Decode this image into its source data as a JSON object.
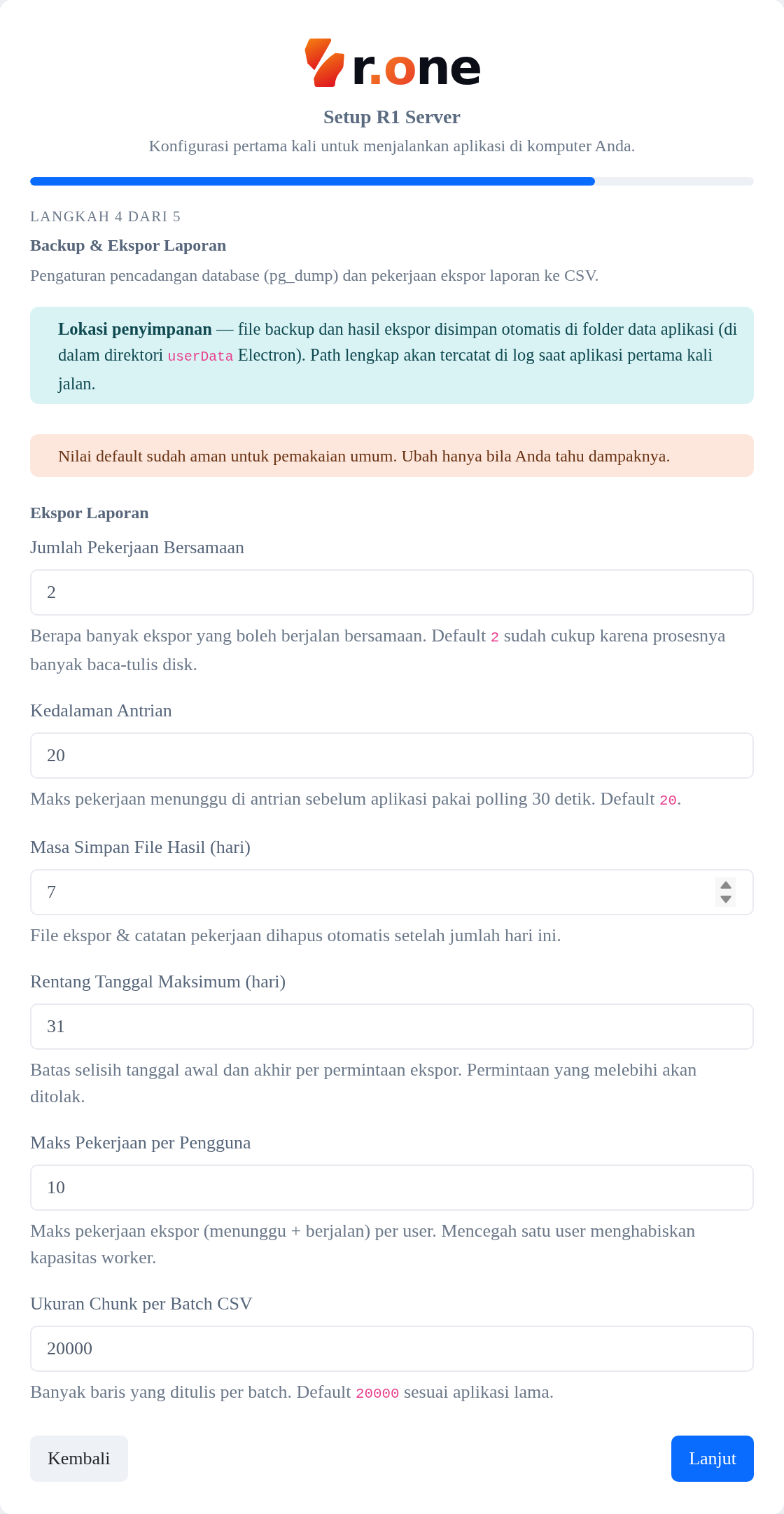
{
  "logo": {
    "wordmark": "r.one"
  },
  "header": {
    "title": "Setup R1 Server",
    "subtitle": "Konfigurasi pertama kali untuk menjalankan aplikasi di komputer Anda."
  },
  "progress": {
    "level": 0.78
  },
  "step": {
    "counter": "LANGKAH 4 DARI 5",
    "title": "Backup & Ekspor Laporan",
    "description": "Pengaturan pencadangan database (pg_dump) dan pekerjaan ekspor laporan ke CSV."
  },
  "alerts": [
    {
      "kind": "info",
      "segments": [
        {
          "kind": "text",
          "text": "**Lokasi penyimpanan** — file backup dan hasil ekspor disimpan otomatis di folder data aplikasi (di dalam direktori "
        },
        {
          "kind": "code",
          "text": "userData"
        },
        {
          "kind": "text",
          "text": " Electron). Path lengkap akan tercatat di log saat aplikasi pertama kali jalan."
        }
      ]
    },
    {
      "kind": "warning",
      "segments": [
        {
          "kind": "text",
          "text": "Nilai default sudah aman untuk pemakaian umum. Ubah hanya bila Anda tahu dampaknya."
        }
      ]
    }
  ],
  "section": {
    "title": "Ekspor Laporan",
    "fields": [
      {
        "label": "Jumlah Pekerjaan Bersamaan",
        "value": "2",
        "spinner": false,
        "help": [
          {
            "kind": "text",
            "text": "Berapa banyak ekspor yang boleh berjalan bersamaan. Default "
          },
          {
            "kind": "code",
            "text": "2"
          },
          {
            "kind": "text",
            "text": " sudah cukup karena prosesnya banyak baca-tulis disk."
          }
        ]
      },
      {
        "label": "Kedalaman Antrian",
        "value": "20",
        "spinner": false,
        "help": [
          {
            "kind": "text",
            "text": "Maks pekerjaan menunggu di antrian sebelum aplikasi pakai polling 30 detik. Default "
          },
          {
            "kind": "code",
            "text": "20"
          },
          {
            "kind": "text",
            "text": "."
          }
        ]
      },
      {
        "label": "Masa Simpan File Hasil (hari)",
        "value": "7",
        "spinner": true,
        "help": [
          {
            "kind": "text",
            "text": "File ekspor & catatan pekerjaan dihapus otomatis setelah jumlah hari ini."
          }
        ]
      },
      {
        "label": "Rentang Tanggal Maksimum (hari)",
        "value": "31",
        "spinner": false,
        "help": [
          {
            "kind": "text",
            "text": "Batas selisih tanggal awal dan akhir per permintaan ekspor. Permintaan yang melebihi akan ditolak."
          }
        ]
      },
      {
        "label": "Maks Pekerjaan per Pengguna",
        "value": "10",
        "spinner": false,
        "help": [
          {
            "kind": "text",
            "text": "Maks pekerjaan ekspor (menunggu + berjalan) per user. Mencegah satu user menghabiskan kapasitas worker."
          }
        ]
      },
      {
        "label": "Ukuran Chunk per Batch CSV",
        "value": "20000",
        "spinner": false,
        "help": [
          {
            "kind": "text",
            "text": "Banyak baris yang ditulis per batch. Default "
          },
          {
            "kind": "code",
            "text": "20000"
          },
          {
            "kind": "text",
            "text": " sesuai aplikasi lama."
          }
        ]
      }
    ]
  },
  "buttons": [
    {
      "label": "Kembali",
      "kind": "secondary"
    },
    {
      "label": "Lanjut",
      "kind": "primary"
    }
  ]
}
